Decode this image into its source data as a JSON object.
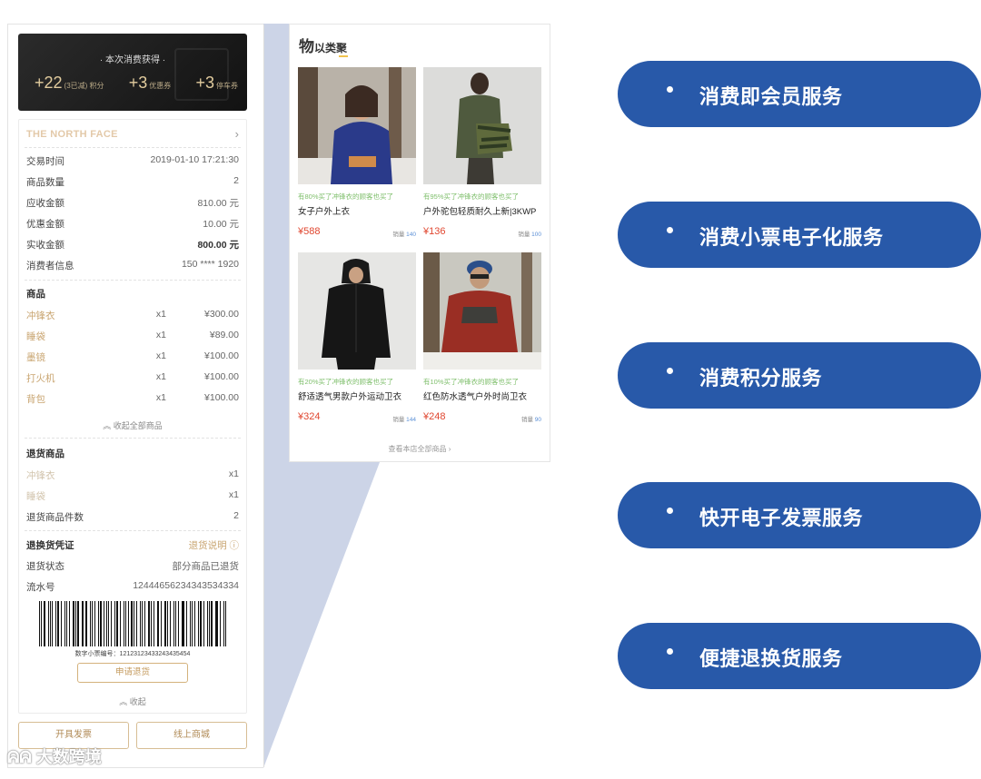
{
  "reward": {
    "title": "· 本次消费获得 ·",
    "points_value": "+22",
    "points_unit": "(3已减) 积分",
    "coupon_value": "+3",
    "coupon_unit": "优惠券",
    "post_value": "+3",
    "post_unit": "停车券"
  },
  "receipt": {
    "brand": "THE NORTH FACE",
    "arrow": "›",
    "info": [
      {
        "label": "交易时间",
        "value": "2019-01-10  17:21:30"
      },
      {
        "label": "商品数量",
        "value": "2"
      },
      {
        "label": "应收金额",
        "value": "810.00 元"
      },
      {
        "label": "优惠金额",
        "value": "10.00 元"
      },
      {
        "label": "实收金额",
        "value": "800.00 元"
      },
      {
        "label": "消费者信息",
        "value": "150 **** 1920"
      }
    ],
    "goods_title": "商品",
    "goods": [
      {
        "name": "冲锋衣",
        "qty": "x1",
        "price": "¥300.00"
      },
      {
        "name": "睡袋",
        "qty": "x1",
        "price": "¥89.00"
      },
      {
        "name": "墨镜",
        "qty": "x1",
        "price": "¥100.00"
      },
      {
        "name": "打火机",
        "qty": "x1",
        "price": "¥100.00"
      },
      {
        "name": "背包",
        "qty": "x1",
        "price": "¥100.00"
      }
    ],
    "collapse_all": "︽ 收起全部商品",
    "return_title": "退货商品",
    "returns": [
      {
        "name": "冲锋衣",
        "qty": "x1"
      },
      {
        "name": "睡袋",
        "qty": "x1"
      }
    ],
    "return_count_label": "退货商品件数",
    "return_count": "2",
    "exchange_title": "退换货凭证",
    "exchange_help": "退货说明 ⓘ",
    "return_status_label": "退货状态",
    "return_status": "部分商品已退货",
    "serial_label": "流水号",
    "serial": "12444656234343534334",
    "barcode_number": "数字小票编号：12123123433243435454",
    "apply_return": "申请退货",
    "collapse": "︽ 收起",
    "invoice_button": "开具发票",
    "mall_button": "线上商城"
  },
  "watermark": "大数跨境",
  "products": {
    "title_big": "物",
    "title_small": "以类聚",
    "items": [
      {
        "hint": "有80%买了冲锋衣的顾客也买了",
        "name": "女子户外上衣",
        "price": "¥588",
        "sales_label": "销量",
        "sales": "140"
      },
      {
        "hint": "有95%买了冲锋衣的顾客也买了",
        "name": "户外驼包轻质耐久上新|3KWP",
        "price": "¥136",
        "sales_label": "销量",
        "sales": "100"
      },
      {
        "hint": "有20%买了冲锋衣的顾客也买了",
        "name": "舒适透气男款户外运动卫衣",
        "price": "¥324",
        "sales_label": "销量",
        "sales": "144"
      },
      {
        "hint": "有10%买了冲锋衣的顾客也买了",
        "name": "红色防水透气户外时尚卫衣",
        "price": "¥248",
        "sales_label": "销量",
        "sales": "90"
      }
    ],
    "see_all": "查看本店全部商品 ›"
  },
  "services": [
    "消费即会员服务",
    "消费小票电子化服务",
    "消费积分服务",
    "快开电子发票服务",
    "便捷退换货服务"
  ],
  "colors": {
    "pill": "#2859a9",
    "gold": "#c9a571",
    "price": "#e0462f",
    "wedge": "#c3cde3"
  }
}
